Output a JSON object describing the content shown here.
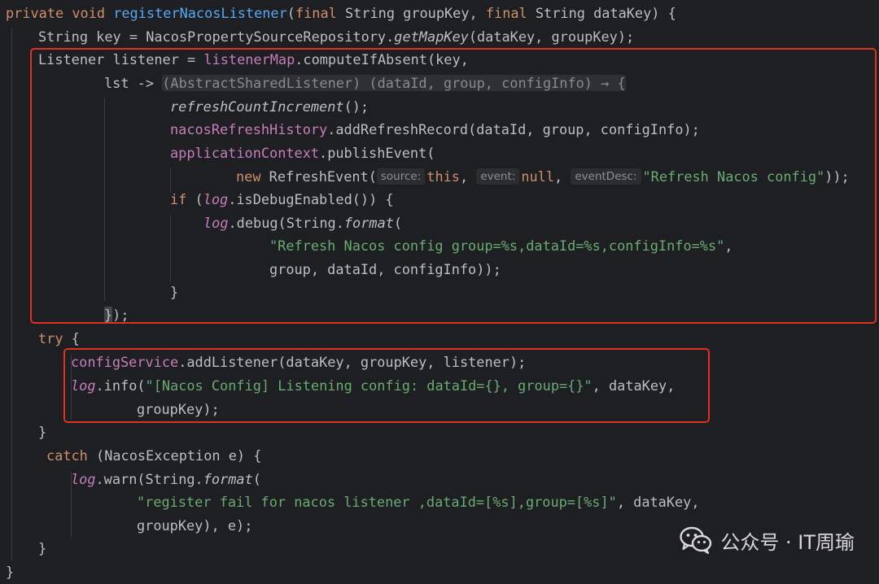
{
  "method_signature": {
    "kw_private": "private",
    "kw_void": "void",
    "name": "registerNacosListener",
    "paren_open": "(",
    "kw_final_1": "final",
    "param_1": " String groupKey, ",
    "kw_final_2": "final",
    "param_2": " String dataKey) {"
  },
  "line_key": {
    "start": "String key = NacosPropertySourceRepository.",
    "method": "getMapKey",
    "end": "(dataKey, groupKey);"
  },
  "line_listener": {
    "start": "Listener listener = ",
    "field": "listenerMap",
    "end": ".computeIfAbsent(key,"
  },
  "line_lambda": {
    "start": "lst -> ",
    "hint": "(AbstractSharedListener) (dataId, group, configInfo) → ",
    "brace": "{"
  },
  "line_refresh_count": {
    "method": "refreshCountIncrement",
    "end": "();"
  },
  "line_history": {
    "field": "nacosRefreshHistory",
    "end": ".addRefreshRecord(dataId, group, configInfo);"
  },
  "line_context": {
    "field": "applicationContext",
    "end": ".publishEvent("
  },
  "line_new_event": {
    "kw_new": "new",
    "class_open": " RefreshEvent(",
    "hint_source": "source:",
    "kw_this": "this",
    "sep_1": ", ",
    "hint_event": "event:",
    "kw_null": "null",
    "sep_2": ", ",
    "hint_desc": "eventDesc:",
    "str": "\"Refresh Nacos config\"",
    "end": "));"
  },
  "line_if": {
    "kw_if": "if",
    "open": " (",
    "log": "log",
    "end": ".isDebugEnabled()) {"
  },
  "line_debug": {
    "log": "log",
    "mid": ".debug(String.",
    "format": "format",
    "end": "("
  },
  "line_debug_str": {
    "str": "\"Refresh Nacos config group=%s,dataId=%s,configInfo=%s\"",
    "end": ","
  },
  "line_debug_args": {
    "text": "group, dataId, configInfo));"
  },
  "line_if_close": {
    "text": "}"
  },
  "line_lambda_close": {
    "brace": "}",
    "end": ");"
  },
  "line_try": {
    "kw_try": "try",
    "end": " {"
  },
  "line_add_listener": {
    "field": "configService",
    "end": ".addListener(dataKey, groupKey, listener);"
  },
  "line_info": {
    "log": "log",
    "mid": ".info(",
    "str": "\"[Nacos Config] Listening config: dataId={}, group={}\"",
    "end": ", dataKey,"
  },
  "line_info_args": {
    "text": "groupKey);"
  },
  "line_try_close": {
    "text": "}"
  },
  "line_catch": {
    "kw_catch": "catch",
    "end": " (NacosException e) {"
  },
  "line_warn": {
    "log": "log",
    "mid": ".warn(String.",
    "format": "format",
    "end": "("
  },
  "line_warn_str": {
    "str": "\"register fail for nacos listener ,dataId=[%s],group=[%s]\"",
    "end": ", dataKey,"
  },
  "line_warn_args": {
    "text": "groupKey), e);"
  },
  "line_catch_close": {
    "text": "}"
  },
  "line_method_close": {
    "text": "}"
  },
  "watermark": {
    "icon": "wechat-icon",
    "text": "公众号 · IT周瑜"
  },
  "colors": {
    "background": "#1e1f22",
    "keyword": "#cf8e6d",
    "method": "#56a8f5",
    "field": "#c77dbb",
    "string": "#6aab73",
    "default": "#bcbec4",
    "highlight_box": "#e0301e"
  }
}
